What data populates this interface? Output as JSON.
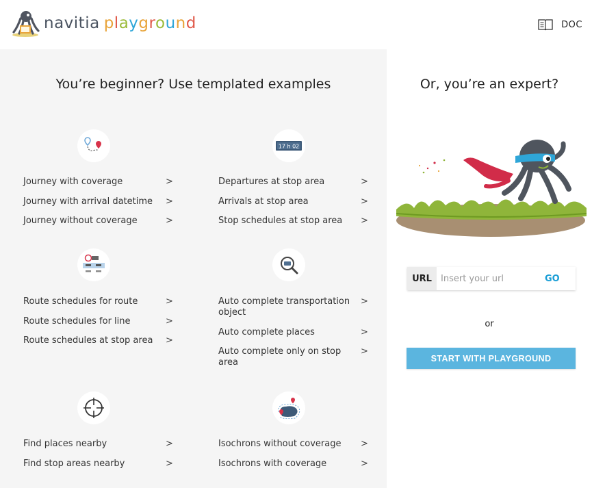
{
  "header": {
    "logo_navitia": "navitia",
    "logo_playground": [
      "p",
      "l",
      "a",
      "y",
      "g",
      "r",
      "o",
      "u",
      "n",
      "d"
    ],
    "logo_colors": [
      "#e8a43a",
      "#e05a4a",
      "#9bbb39",
      "#2fa6d8",
      "#e8a43a",
      "#e05a4a",
      "#9bbb39",
      "#2fa6d8",
      "#e8a43a",
      "#e05a4a"
    ],
    "doc_label": "DOC"
  },
  "left": {
    "title": "You’re beginner? Use templated examples",
    "categories": [
      {
        "icon": "journey-icon",
        "items": [
          "Journey with coverage",
          "Journey with arrival datetime",
          "Journey without coverage"
        ]
      },
      {
        "icon": "departures-board-icon",
        "board_text": "17 h 02",
        "items": [
          "Departures at stop area",
          "Arrivals at stop area",
          "Stop schedules at stop area"
        ]
      },
      {
        "icon": "route-schedule-icon",
        "items": [
          "Route schedules for route",
          "Route schedules for line",
          "Route schedules at stop area"
        ]
      },
      {
        "icon": "autocomplete-search-icon",
        "items": [
          "Auto complete transportation object",
          "Auto complete places",
          "Auto complete only on stop area"
        ]
      },
      {
        "icon": "crosshair-icon",
        "items": [
          "Find places nearby",
          "Find stop areas nearby"
        ]
      },
      {
        "icon": "isochron-icon",
        "items": [
          "Isochrons without coverage",
          "Isochrons with coverage"
        ]
      }
    ],
    "arrow": ">"
  },
  "right": {
    "title": "Or, you’re an expert?",
    "url_label": "URL",
    "url_placeholder": "Insert your url",
    "go_label": "GO",
    "or_text": "or",
    "start_label": "START WITH PLAYGROUND"
  },
  "colors": {
    "accent": "#1a9ed6",
    "button": "#5bb5df",
    "panel_bg": "#f5f5f5"
  }
}
